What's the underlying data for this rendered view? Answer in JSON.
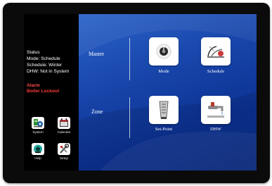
{
  "status": {
    "heading": "Status",
    "mode": "Mode: Schedule",
    "schedule": "Schedule: Winter",
    "dhw": "DHW: Not in System"
  },
  "alarm": {
    "heading": "Alarm",
    "value": "Boiler Lockout",
    "color": "#ff3b3b"
  },
  "sidebar": {
    "buttons": [
      {
        "label": "System",
        "icon": "system-icon"
      },
      {
        "label": "Calendar",
        "icon": "calendar-icon"
      },
      {
        "label": "Help",
        "icon": "help-icon"
      },
      {
        "label": "Setup",
        "icon": "setup-icon"
      }
    ]
  },
  "main": {
    "master_label": "Master",
    "zone_label": "Zone",
    "tiles": [
      {
        "label": "Mode",
        "icon": "mode-icon"
      },
      {
        "label": "Schedule",
        "icon": "schedule-icon"
      },
      {
        "label": "Set-Point",
        "icon": "set-point-icon"
      },
      {
        "label": "DHW",
        "icon": "faucet-icon"
      }
    ]
  },
  "colors": {
    "background_blue": "#1744a8",
    "panel_black": "#000000"
  }
}
